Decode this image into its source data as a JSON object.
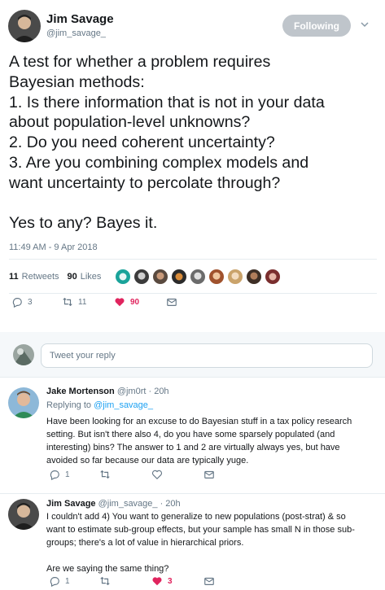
{
  "main_tweet": {
    "author_name": "Jim Savage",
    "author_handle": "@jim_savage_",
    "follow_label": "Following",
    "text": "A test for whether a problem requires\nBayesian methods:\n1. Is there information that is not in your data\nabout population-level unknowns?\n2. Do you need coherent uncertainty?\n3. Are you combining complex models and\nwant uncertainty to percolate through?\n\nYes to any? Bayes it.",
    "timestamp": "11:49 AM - 9 Apr 2018",
    "retweets_count": "11",
    "retweets_label": "Retweets",
    "likes_count": "90",
    "likes_label": "Likes",
    "actions": {
      "reply_count": "3",
      "retweet_count": "11",
      "like_count": "90"
    }
  },
  "reply_box": {
    "placeholder": "Tweet your reply"
  },
  "replies": [
    {
      "author_name": "Jake Mortenson",
      "meta": "@jm0rt · 20h",
      "replying_prefix": "Replying to",
      "replying_to": "@jim_savage_",
      "text": "Have been looking for an excuse to do Bayesian stuff in a tax policy research\nsetting. But isn't there also 4, do you have some sparsely populated (and\ninteresting) bins? The answer to 1 and 2 are virtually always yes, but have\navoided so far because our data are typically yuge.",
      "reply_count": "1",
      "retweet_count": "",
      "like_count": ""
    },
    {
      "author_name": "Jim Savage",
      "meta": "@jim_savage_ · 20h",
      "text": "I couldn't add 4) You want to generalize to new populations (post-strat) & so\nwant to estimate sub-group effects, but your sample has small N in those sub-\ngroups; there's a lot of value in hierarchical priors.\n\nAre we saying the same thing?",
      "reply_count": "1",
      "retweet_count": "",
      "like_count": "3"
    }
  ],
  "colors": {
    "accent": "#1da1f2",
    "like": "#e0245e",
    "muted": "#657786",
    "follow_button": "#bfc5cb"
  },
  "icons": [
    "reply-icon",
    "retweet-icon",
    "like-icon",
    "dm-icon",
    "chevron-down-icon"
  ]
}
